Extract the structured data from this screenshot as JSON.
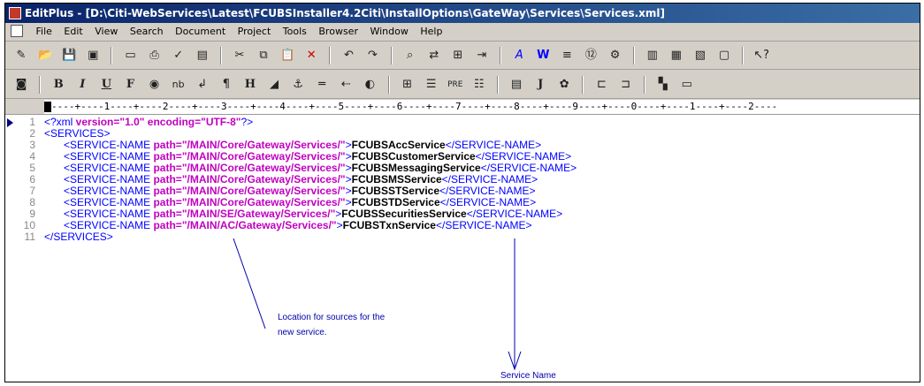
{
  "window": {
    "title": "EditPlus - [D:\\Citi-WebServices\\Latest\\FCUBSInstaller4.2Citi\\InstallOptions\\GateWay\\Services\\Services.xml]"
  },
  "menubar": {
    "items": [
      "File",
      "Edit",
      "View",
      "Search",
      "Document",
      "Project",
      "Tools",
      "Browser",
      "Window",
      "Help"
    ]
  },
  "ruler": {
    "text": "----+----1----+----2----+----3----+----4----+----5----+----6----+----7----+----8----+----9----+----0----+----1----+----2----"
  },
  "editor": {
    "lines": [
      {
        "n": "1",
        "declaration": "<?xml",
        "attr1": " version=",
        "val1": "\"1.0\"",
        "attr2": " encoding=",
        "val2": "\"UTF-8\"",
        "end": "?>"
      },
      {
        "n": "2",
        "open": "<SERVICES>"
      },
      {
        "n": "3",
        "tag": "<SERVICE-NAME",
        "attr": " path=",
        "path": "\"/MAIN/Core/Gateway/Services/\"",
        "gt": ">",
        "text": "FCUBSAccService",
        "close": "</SERVICE-NAME>"
      },
      {
        "n": "4",
        "tag": "<SERVICE-NAME",
        "attr": " path=",
        "path": "\"/MAIN/Core/Gateway/Services/\"",
        "gt": ">",
        "text": "FCUBSCustomerService",
        "close": "</SERVICE-NAME>"
      },
      {
        "n": "5",
        "tag": "<SERVICE-NAME",
        "attr": " path=",
        "path": "\"/MAIN/Core/Gateway/Services/\"",
        "gt": ">",
        "text": "FCUBSMessagingService",
        "close": "</SERVICE-NAME>"
      },
      {
        "n": "6",
        "tag": "<SERVICE-NAME",
        "attr": " path=",
        "path": "\"/MAIN/Core/Gateway/Services/\"",
        "gt": ">",
        "text": "FCUBSMSService",
        "close": "</SERVICE-NAME>"
      },
      {
        "n": "7",
        "tag": "<SERVICE-NAME",
        "attr": " path=",
        "path": "\"/MAIN/Core/Gateway/Services/\"",
        "gt": ">",
        "text": "FCUBSSTService",
        "close": "</SERVICE-NAME>"
      },
      {
        "n": "8",
        "tag": "<SERVICE-NAME",
        "attr": " path=",
        "path": "\"/MAIN/Core/Gateway/Services/\"",
        "gt": ">",
        "text": "FCUBSTDService",
        "close": "</SERVICE-NAME>"
      },
      {
        "n": "9",
        "tag": "<SERVICE-NAME",
        "attr": " path=",
        "path": "\"/MAIN/SE/Gateway/Services/\"",
        "gt": ">",
        "text": "FCUBSSecuritiesService",
        "close": "</SERVICE-NAME>"
      },
      {
        "n": "10",
        "tag": "<SERVICE-NAME",
        "attr": " path=",
        "path": "\"/MAIN/AC/Gateway/Services/\"",
        "gt": ">",
        "text": "FCUBSTxnService",
        "close": "</SERVICE-NAME>"
      },
      {
        "n": "11",
        "open": "</SERVICES>"
      }
    ]
  },
  "annotations": {
    "location_line1": "Location for sources for the",
    "location_line2": "new service.",
    "service_name": "Service Name"
  }
}
